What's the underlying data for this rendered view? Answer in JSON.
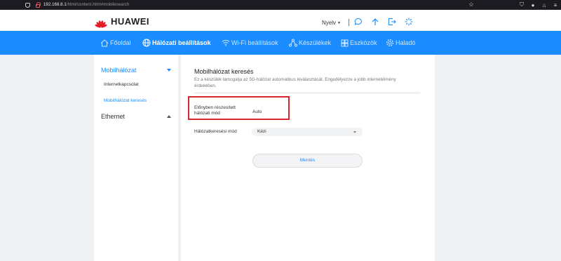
{
  "browser": {
    "url_host": "192.168.8.1",
    "url_path": "/html/content.html#mobilesearch"
  },
  "header": {
    "brand": "HUAWEI",
    "language_label": "Nyelv"
  },
  "nav": {
    "items": [
      {
        "label": "Főoldal",
        "icon": "home-icon"
      },
      {
        "label": "Hálózati beállítások",
        "icon": "globe-icon"
      },
      {
        "label": "Wi-Fi beállítások",
        "icon": "wifi-icon"
      },
      {
        "label": "Készülékek",
        "icon": "devices-icon"
      },
      {
        "label": "Eszközök",
        "icon": "tools-icon"
      },
      {
        "label": "Haladó",
        "icon": "gear-icon"
      }
    ],
    "active_index": 1
  },
  "sidebar": {
    "mobile_network": "Mobilhálózat",
    "items": [
      "Internetkapcsolat",
      "Mobilhálózat keresés"
    ],
    "ethernet": "Ethernet"
  },
  "main": {
    "title": "Mobilhálózat keresés",
    "description": "Ez a készülék támogatja az 5G-hálózat automatikus kiválasztását. Engedélyezze a jobb internetélmény érdekében.",
    "preferred_mode_label": "Előnyben részesített hálózati mód",
    "preferred_mode_value": "Auto",
    "search_mode_label": "Hálózatkeresési mód",
    "search_mode_value": "Kézi",
    "save_label": "Mentés"
  },
  "colors": {
    "accent": "#1a8cff",
    "highlight_border": "#d9232e"
  }
}
